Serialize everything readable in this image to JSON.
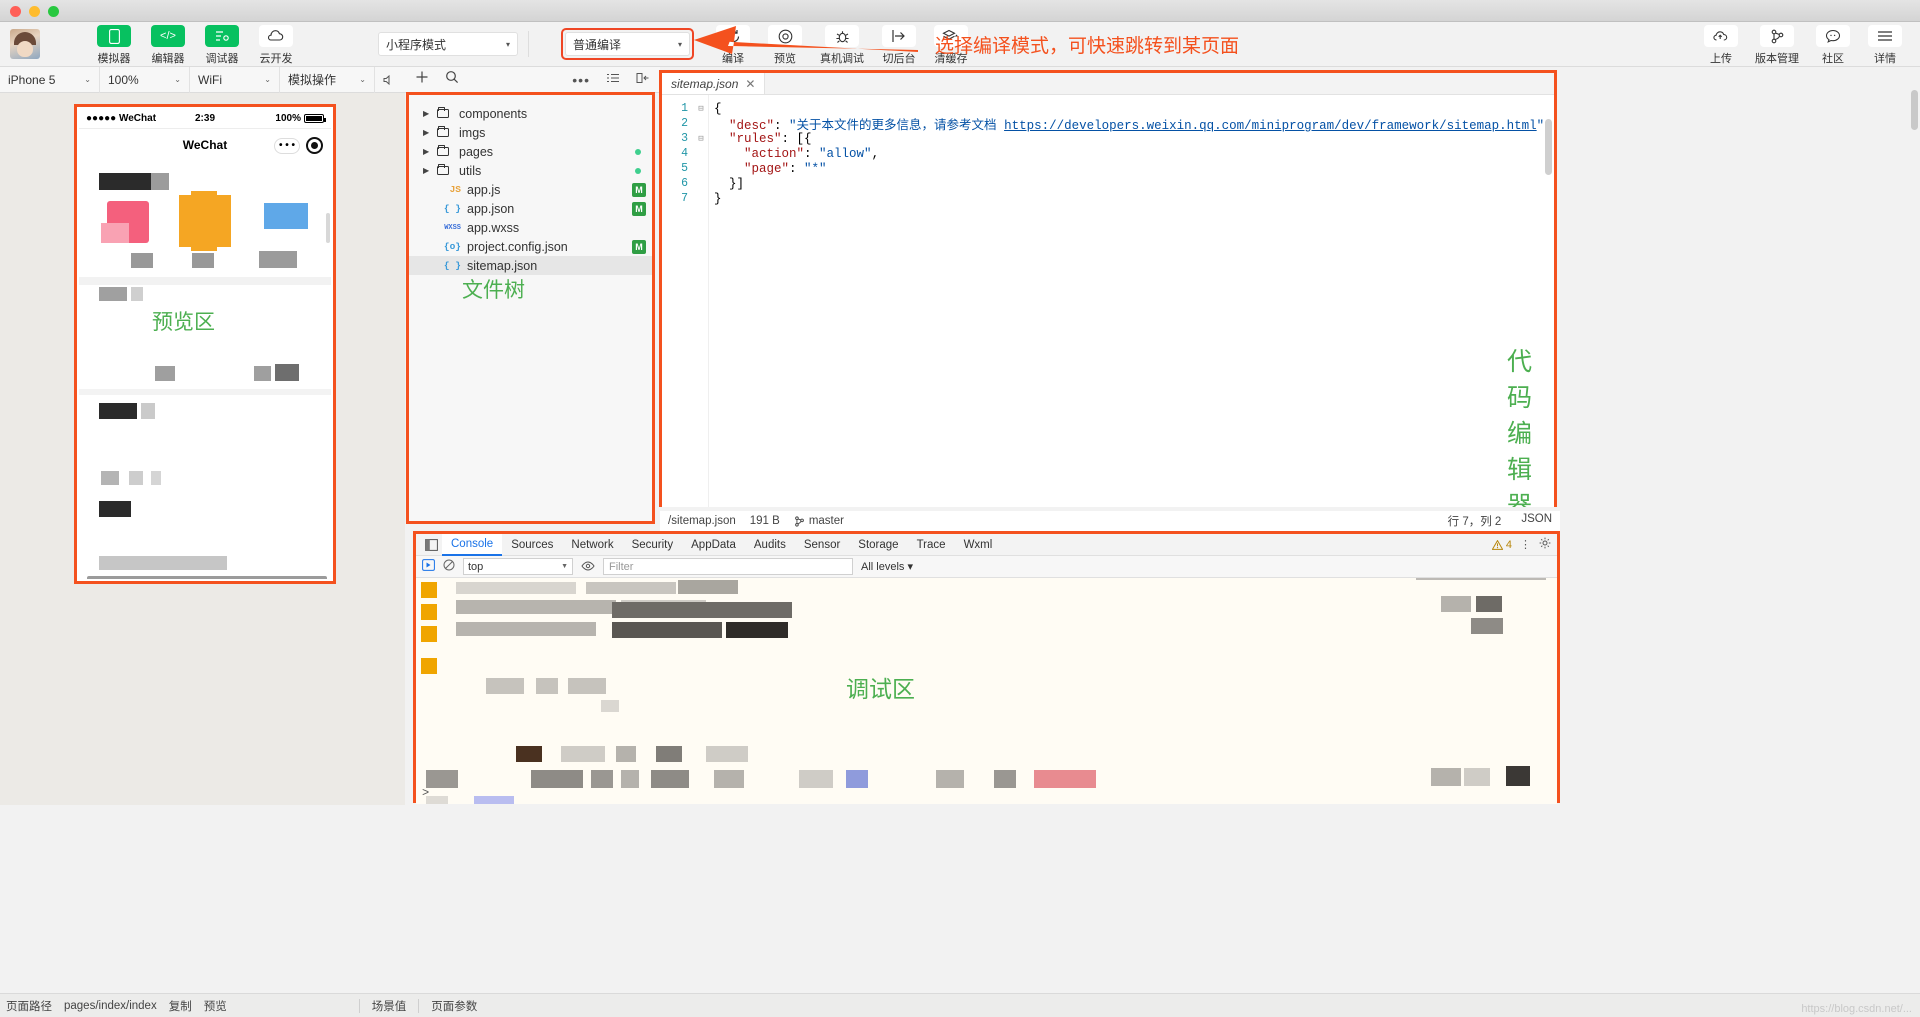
{
  "window": {
    "traffic_lights": [
      "close",
      "minimize",
      "maximize"
    ]
  },
  "toolbar": {
    "buttons": [
      {
        "label": "模拟器",
        "icon": "phone-icon",
        "style": "green"
      },
      {
        "label": "编辑器",
        "icon": "code-icon",
        "style": "green"
      },
      {
        "label": "调试器",
        "icon": "debugger-icon",
        "style": "green"
      },
      {
        "label": "云开发",
        "icon": "cloud-icon",
        "style": "white"
      }
    ],
    "mode_select": {
      "value": "小程序模式",
      "caret": "▾"
    },
    "compile_select": {
      "value": "普通编译",
      "caret": "▾"
    },
    "actions": [
      {
        "label": "编译",
        "icon": "refresh-icon"
      },
      {
        "label": "预览",
        "icon": "qrcode-icon"
      },
      {
        "label": "真机调试",
        "icon": "bug-icon"
      },
      {
        "label": "切后台",
        "icon": "background-icon"
      },
      {
        "label": "清缓存",
        "icon": "layers-icon"
      }
    ],
    "right_actions": [
      {
        "label": "上传",
        "icon": "upload-cloud-icon"
      },
      {
        "label": "版本管理",
        "icon": "branch-icon"
      },
      {
        "label": "社区",
        "icon": "chat-icon"
      },
      {
        "label": "详情",
        "icon": "menu-icon"
      }
    ],
    "annotation": "选择编译模式，可快速跳转到某页面"
  },
  "devicebar": {
    "device": {
      "value": "iPhone 5",
      "caret": "⌄"
    },
    "zoom": {
      "value": "100%",
      "caret": "⌄"
    },
    "network": {
      "value": "WiFi",
      "caret": "⌄"
    },
    "simulate": {
      "value": "模拟操作",
      "caret": "⌄"
    },
    "icons": [
      "volume-icon",
      "screen-icon"
    ]
  },
  "filetree_toolbar": {
    "icons": [
      "add-icon",
      "search-icon"
    ]
  },
  "editor_toolbar": {
    "icons": [
      "more-icon",
      "outline-icon",
      "collapse-icon"
    ]
  },
  "preview": {
    "annotation": "预览区",
    "status_bar": {
      "carrier": "●●●●● WeChat",
      "wifi": "⌃",
      "time": "2:39",
      "battery_text": "100%"
    },
    "nav_title": "WeChat"
  },
  "filetree": {
    "annotation": "文件树",
    "items": [
      {
        "name": "components",
        "type": "folder",
        "arrow": "▶",
        "badge": "",
        "dot": false,
        "selected": false
      },
      {
        "name": "imgs",
        "type": "folder",
        "arrow": "▶",
        "badge": "",
        "dot": false,
        "selected": false
      },
      {
        "name": "pages",
        "type": "folder",
        "arrow": "▶",
        "badge": "",
        "dot": true,
        "selected": false
      },
      {
        "name": "utils",
        "type": "folder",
        "arrow": "▶",
        "badge": "",
        "dot": true,
        "selected": false
      },
      {
        "name": "app.js",
        "type": "js",
        "ext_label": "JS",
        "arrow": "",
        "badge": "M",
        "dot": false,
        "selected": false
      },
      {
        "name": "app.json",
        "type": "json",
        "ext_label": "{ }",
        "arrow": "",
        "badge": "M",
        "dot": false,
        "selected": false
      },
      {
        "name": "app.wxss",
        "type": "wxss",
        "ext_label": "WXSS",
        "arrow": "",
        "badge": "",
        "dot": false,
        "selected": false
      },
      {
        "name": "project.config.json",
        "type": "json",
        "ext_label": "{o}",
        "arrow": "",
        "badge": "M",
        "dot": false,
        "selected": false
      },
      {
        "name": "sitemap.json",
        "type": "json",
        "ext_label": "{ }",
        "arrow": "",
        "badge": "",
        "dot": false,
        "selected": true
      }
    ]
  },
  "editor": {
    "annotation": "代码编辑器",
    "tab": {
      "name": "sitemap.json",
      "close": "✕"
    },
    "lines": [
      {
        "no": "1",
        "fold": "⊟",
        "parts": [
          {
            "t": "{",
            "c": "p"
          }
        ]
      },
      {
        "no": "2",
        "fold": "",
        "parts": [
          {
            "t": "  ",
            "c": "p"
          },
          {
            "t": "\"desc\"",
            "c": "k"
          },
          {
            "t": ": ",
            "c": "p"
          },
          {
            "t": "\"关于本文件的更多信息，请参考文档 ",
            "c": "s"
          },
          {
            "t": "https://developers.weixin.qq.com/miniprogram/dev/framework/sitemap.html",
            "c": "lnk"
          },
          {
            "t": "\"",
            "c": "s"
          },
          {
            "t": ",",
            "c": "p"
          }
        ]
      },
      {
        "no": "3",
        "fold": "⊟",
        "parts": [
          {
            "t": "  ",
            "c": "p"
          },
          {
            "t": "\"rules\"",
            "c": "k"
          },
          {
            "t": ": [{",
            "c": "p"
          }
        ]
      },
      {
        "no": "4",
        "fold": "",
        "parts": [
          {
            "t": "    ",
            "c": "p"
          },
          {
            "t": "\"action\"",
            "c": "k"
          },
          {
            "t": ": ",
            "c": "p"
          },
          {
            "t": "\"allow\"",
            "c": "s"
          },
          {
            "t": ",",
            "c": "p"
          }
        ]
      },
      {
        "no": "5",
        "fold": "",
        "parts": [
          {
            "t": "    ",
            "c": "p"
          },
          {
            "t": "\"page\"",
            "c": "k"
          },
          {
            "t": ": ",
            "c": "p"
          },
          {
            "t": "\"*\"",
            "c": "s"
          }
        ]
      },
      {
        "no": "6",
        "fold": "",
        "parts": [
          {
            "t": "  }]",
            "c": "p"
          }
        ]
      },
      {
        "no": "7",
        "fold": "",
        "parts": [
          {
            "t": "}",
            "c": "p"
          }
        ]
      }
    ],
    "status": {
      "path": "/sitemap.json",
      "size": "191 B",
      "branch_icon": "branch-icon",
      "branch": "master",
      "cursor": "行 7，列 2",
      "language": "JSON"
    }
  },
  "console": {
    "annotation": "调试区",
    "dock_icon": "dock-icon",
    "tabs": [
      {
        "label": "Console",
        "active": true
      },
      {
        "label": "Sources",
        "active": false
      },
      {
        "label": "Network",
        "active": false
      },
      {
        "label": "Security",
        "active": false
      },
      {
        "label": "AppData",
        "active": false
      },
      {
        "label": "Audits",
        "active": false
      },
      {
        "label": "Sensor",
        "active": false
      },
      {
        "label": "Storage",
        "active": false
      },
      {
        "label": "Trace",
        "active": false
      },
      {
        "label": "Wxml",
        "active": false
      }
    ],
    "warning_count": "4",
    "warning_icon": "warning-icon",
    "more_icon": "kebab-icon",
    "settings_icon": "gear-icon",
    "toolbar": {
      "execute_icon": "play-icon",
      "clear_icon": "clear-icon",
      "context": "top",
      "eye_icon": "eye-icon",
      "filter_placeholder": "Filter",
      "levels": "All levels ▾"
    },
    "prompt": ">"
  },
  "bottombar": {
    "page_path_label": "页面路径",
    "page_path_value": "pages/index/index",
    "copy": "复制",
    "preview": "预览",
    "scene_value": "场景值",
    "page_params": "页面参数",
    "watermark": "https://blog.csdn.net/..."
  },
  "colors": {
    "accent_green": "#07c160",
    "annotation_red": "#f4511e",
    "annotation_green": "#4caf50",
    "link_blue": "#0451a5"
  }
}
